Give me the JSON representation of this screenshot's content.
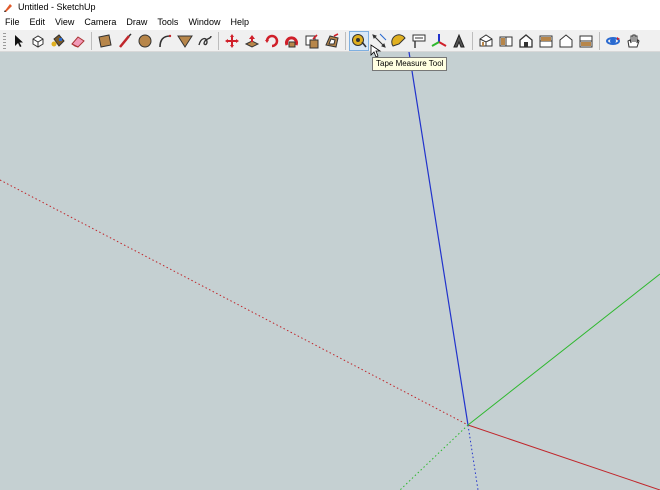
{
  "window": {
    "title": "Untitled - SketchUp"
  },
  "menu": [
    "File",
    "Edit",
    "View",
    "Camera",
    "Draw",
    "Tools",
    "Window",
    "Help"
  ],
  "toolbar": {
    "tools": [
      "select-icon",
      "make-component-icon",
      "paint-bucket-icon",
      "eraser-icon",
      "rectangle-icon",
      "line-icon",
      "circle-icon",
      "arc-icon",
      "polygon-icon",
      "freehand-icon",
      "move-icon",
      "push-pull-icon",
      "rotate-icon",
      "follow-me-icon",
      "scale-icon",
      "offset-icon",
      "tape-measure-icon",
      "dimension-icon",
      "protractor-icon",
      "text-icon",
      "axes-icon",
      "3d-text-icon",
      "iso-view-icon",
      "top-view-icon",
      "front-view-icon",
      "right-view-icon",
      "back-view-icon",
      "left-view-icon",
      "orbit-icon",
      "pan-icon"
    ],
    "active_tool": "tape-measure-icon"
  },
  "tooltip": {
    "text": "Tape Measure Tool"
  },
  "viewport": {
    "background": "#c5d0d2",
    "axis_colors": {
      "red": "#c0262b",
      "green": "#2eb82e",
      "blue": "#2233cc"
    }
  }
}
